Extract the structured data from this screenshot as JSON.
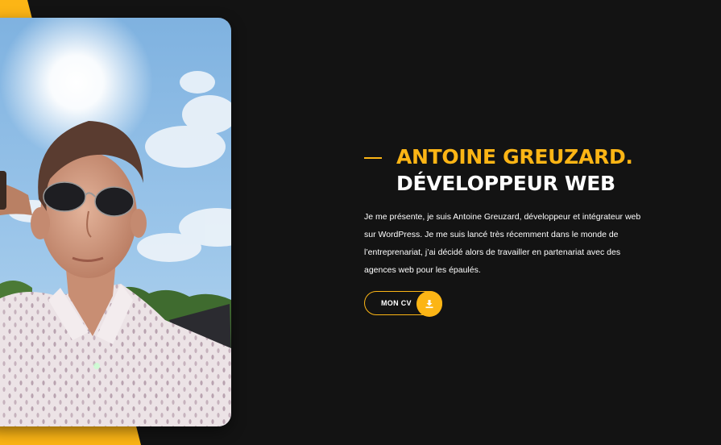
{
  "hero": {
    "name": "ANTOINE GREUZARD.",
    "role": "DÉVELOPPEUR WEB",
    "intro": "Je me présente, je suis Antoine Greuzard, développeur et intégrateur web sur WordPress. Je me suis lancé très récemment dans le monde de l’entreprenariat, j’ai décidé alors de travailler en partenariat avec des agences web pour les épaulés.",
    "cv_button_label": "MON CV",
    "cv_icon": "download-icon"
  },
  "colors": {
    "accent": "#fcb515",
    "background": "#131313",
    "text": "#ffffff"
  }
}
